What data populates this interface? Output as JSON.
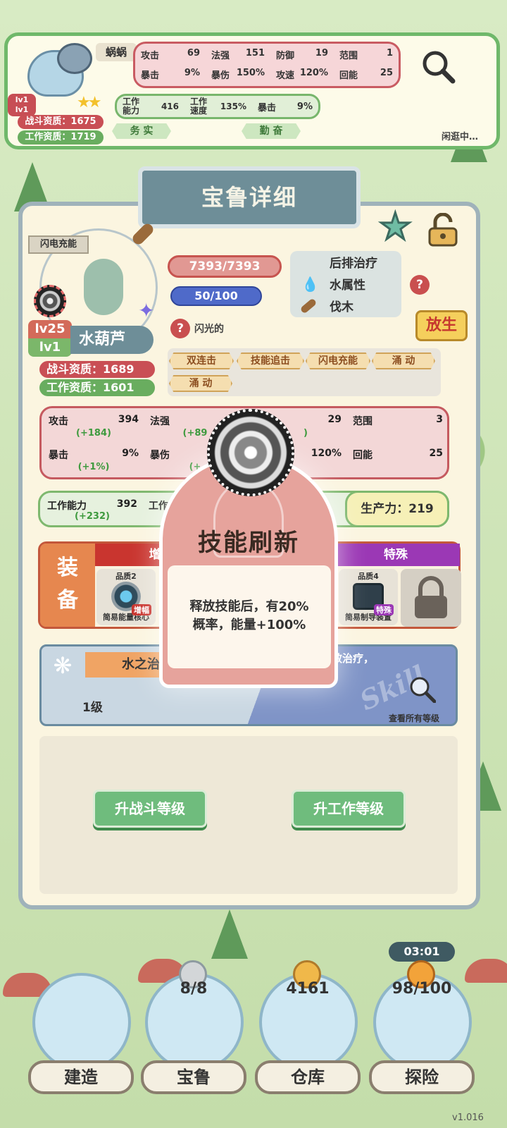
{
  "top_card": {
    "name": "蜗蜗",
    "lv_top": "lv1",
    "lv_bottom": "lv1",
    "combat_aptitude": "战斗资质：1675",
    "work_aptitude": "工作资质：1719",
    "stats": [
      {
        "label": "攻击",
        "value": "69"
      },
      {
        "label": "法强",
        "value": "151"
      },
      {
        "label": "防御",
        "value": "19"
      },
      {
        "label": "范围",
        "value": "1"
      },
      {
        "label": "暴击",
        "value": "9%"
      },
      {
        "label": "暴伤",
        "value": "150%"
      },
      {
        "label": "攻速",
        "value": "120%"
      },
      {
        "label": "回能",
        "value": "25"
      }
    ],
    "work_stats": [
      {
        "label": "工作\n能力",
        "value": "416"
      },
      {
        "label": "工作\n速度",
        "value": "135%"
      },
      {
        "label": "暴击",
        "value": "9%"
      }
    ],
    "traits": [
      "务 实",
      "勤 奋"
    ],
    "status": "闲逛中…"
  },
  "panel": {
    "title": "宝鲁详细",
    "flash_tag": "闪电充能",
    "hp": "7393/7393",
    "energy": "50/100",
    "info": [
      "后排治疗",
      "水属性",
      "伐木"
    ],
    "release_label": "放生",
    "shiny_label": "闪光的",
    "lv_top": "lv25",
    "lv_bottom": "lv1",
    "pet_name": "水葫芦",
    "combat_aptitude": "战斗资质：1689",
    "work_aptitude": "工作资质：1601",
    "skill_tags": [
      "双连击",
      "技能追击",
      "闪电充能",
      "涌 动",
      "涌 动"
    ],
    "combat_stats": [
      {
        "label": "攻击",
        "value": "394",
        "delta": "(+184)"
      },
      {
        "label": "法强",
        "value": "",
        "delta": "(+89"
      },
      {
        "label": "",
        "value": "29",
        "delta": ")"
      },
      {
        "label": "范围",
        "value": "3",
        "delta": ""
      },
      {
        "label": "暴击",
        "value": "9%",
        "delta": "(+1%)"
      },
      {
        "label": "暴伤",
        "value": "",
        "delta": "(+"
      },
      {
        "label": "",
        "value": "120%",
        "delta": ""
      },
      {
        "label": "回能",
        "value": "25",
        "delta": ""
      }
    ],
    "work_stats": {
      "label": "工作能力",
      "value": "392",
      "delta": "(+232)",
      "label2": "工作",
      "pct": "%"
    },
    "productivity": "生产力：219",
    "equip_label": "装\n备",
    "equip_heads": [
      "增",
      "特殊"
    ],
    "equip_slots": [
      {
        "quality": "品质2",
        "tag": "增幅",
        "name": "简易能量核心"
      },
      {
        "quality": "品质4",
        "tag": "特殊",
        "name": "简易制导装置"
      }
    ],
    "skill": {
      "name": "水之治疗",
      "level": "1级",
      "desc_partial": "效治疗，",
      "watermark": "Skill",
      "view_all": "查看所有等级"
    },
    "buttons": [
      "升战斗等级",
      "升工作等级"
    ]
  },
  "popup": {
    "title": "技能刷新",
    "desc": "释放技能后，有20%\n概率，能量+100%"
  },
  "nav": [
    {
      "label": "建造",
      "count": ""
    },
    {
      "label": "宝鲁",
      "count": "8/8"
    },
    {
      "label": "仓库",
      "count": "4161"
    },
    {
      "label": "探险",
      "count": "98/100"
    }
  ],
  "timer": "03:01",
  "version": "v1.016"
}
